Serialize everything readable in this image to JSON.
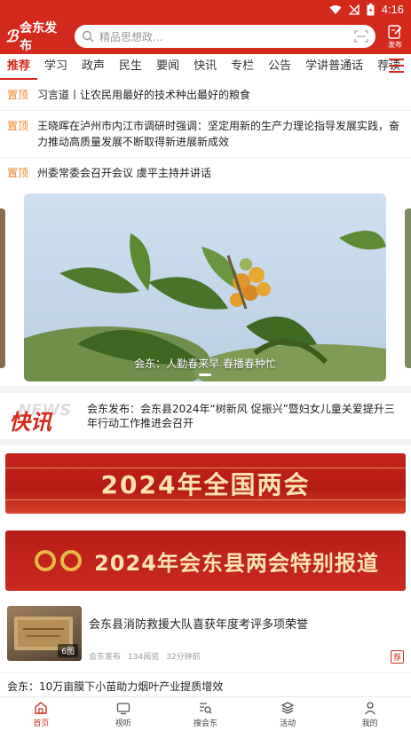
{
  "statusbar": {
    "time": "4:16"
  },
  "header": {
    "logo_text": "会东发布",
    "search_placeholder": "精品思想政...",
    "publish_label": "发布"
  },
  "tabs": [
    "推荐",
    "学习",
    "政声",
    "民生",
    "要闻",
    "快讯",
    "专栏",
    "公告",
    "学讲普通话",
    "荐读"
  ],
  "pinned": [
    {
      "tag": "置顶",
      "title": "习言道丨让农民用最好的技术种出最好的粮食"
    },
    {
      "tag": "置顶",
      "title": "王晓晖在泸州市内江市调研时强调：坚定用新的生产力理论指导发展实践，奋力推动高质量发展不断取得新进展新成效"
    },
    {
      "tag": "置顶",
      "title": "州委常委会召开会议 虞平主持并讲话"
    }
  ],
  "carousel": {
    "caption": "会东：人勤春来早 春播春种忙"
  },
  "flash": {
    "logo_bg": "NEWS",
    "logo_fg": "快讯",
    "text": "会东发布：会东县2024年“树新风 促振兴”暨妇女儿童关爱提升三年行动工作推进会召开"
  },
  "banners": {
    "banner1": "2024年全国两会",
    "banner2": "2024年会东县两会特别报道"
  },
  "article": {
    "title": "会东县消防救援大队喜获年度考评多项荣誉",
    "image_count": "6图",
    "source": "会东发布",
    "views": "134阅览",
    "time": "32分钟前",
    "tag": "荐"
  },
  "next_article": {
    "title": "会东：10万亩膜下小苗助力烟叶产业提质增效"
  },
  "bottom_nav": [
    {
      "label": "首页",
      "icon": "home-icon"
    },
    {
      "label": "视听",
      "icon": "tv-icon"
    },
    {
      "label": "搜会东",
      "icon": "search-doc-icon"
    },
    {
      "label": "活动",
      "icon": "layers-icon"
    },
    {
      "label": "我的",
      "icon": "user-icon"
    }
  ],
  "colors": {
    "brand_red": "#d42a1e",
    "pin_orange": "#e8862a"
  }
}
